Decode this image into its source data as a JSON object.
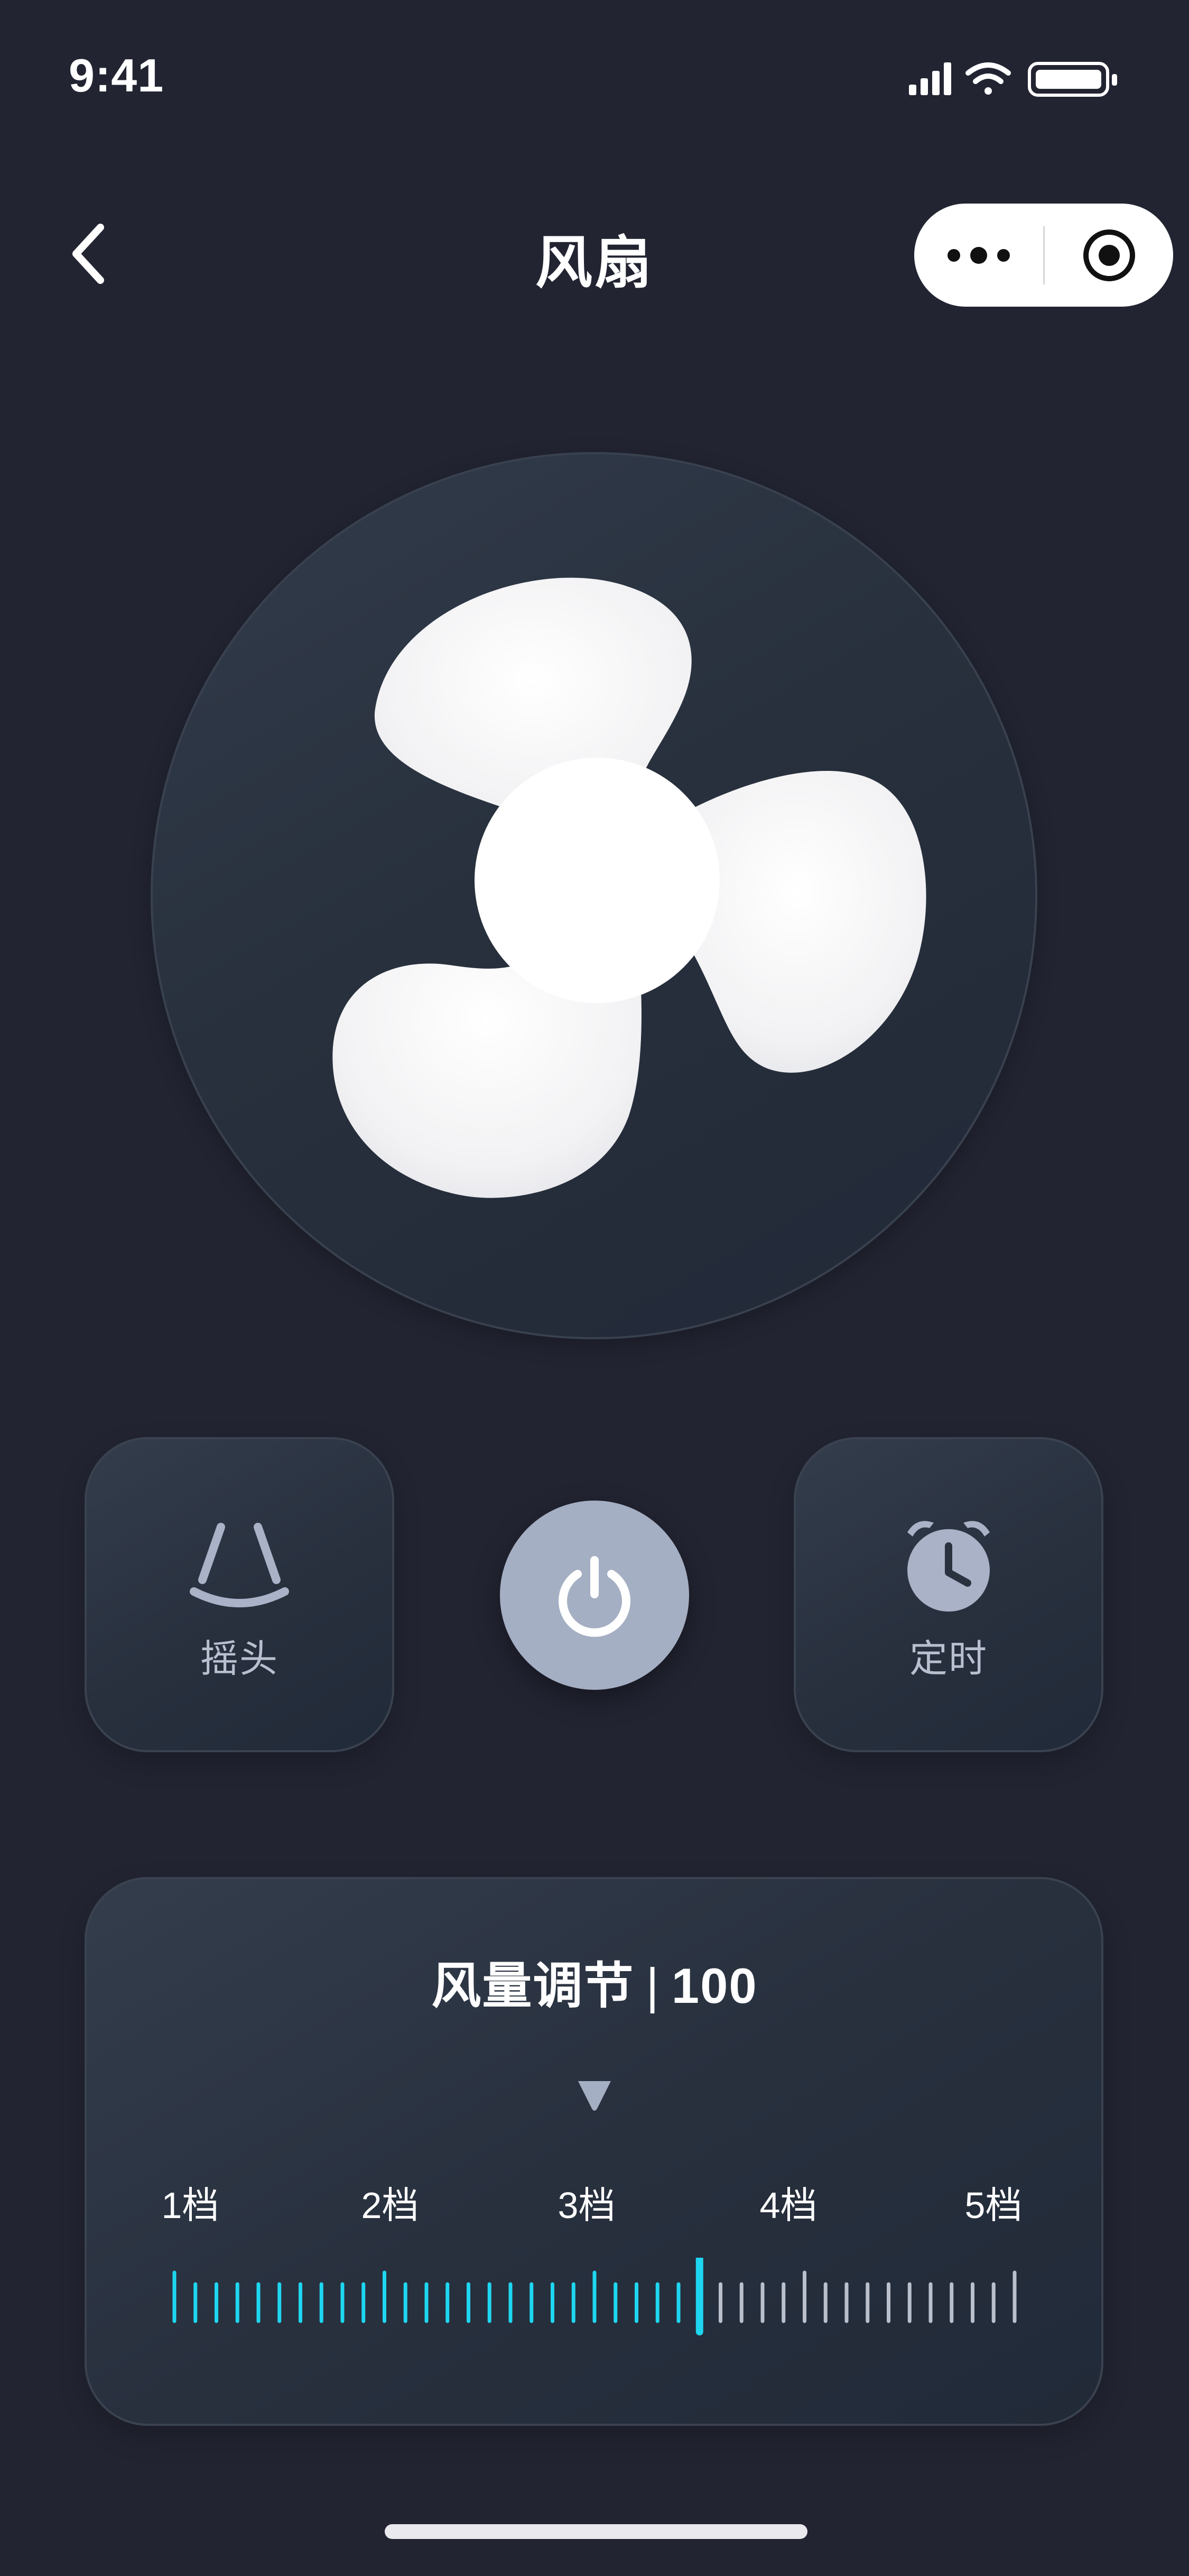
{
  "status_bar": {
    "time": "9:41"
  },
  "nav": {
    "title": "风扇"
  },
  "controls": {
    "swing_label": "摇头",
    "timer_label": "定时"
  },
  "wind": {
    "title": "风量调节",
    "separator": "|",
    "value": "100",
    "gears": [
      "1档",
      "2档",
      "3档",
      "4档",
      "5档"
    ],
    "selected_gear": 3
  },
  "colors": {
    "background": "#222432",
    "accent": "#1ed6f0",
    "power_button": "#a5afc3",
    "tick_inactive": "#b9c0cc"
  },
  "icons": {
    "back": "chevron-left-icon",
    "more": "more-dots-icon",
    "target": "target-icon",
    "swing": "swing-icon",
    "power": "power-icon",
    "timer": "alarm-clock-icon",
    "pointer": "triangle-down-icon"
  }
}
